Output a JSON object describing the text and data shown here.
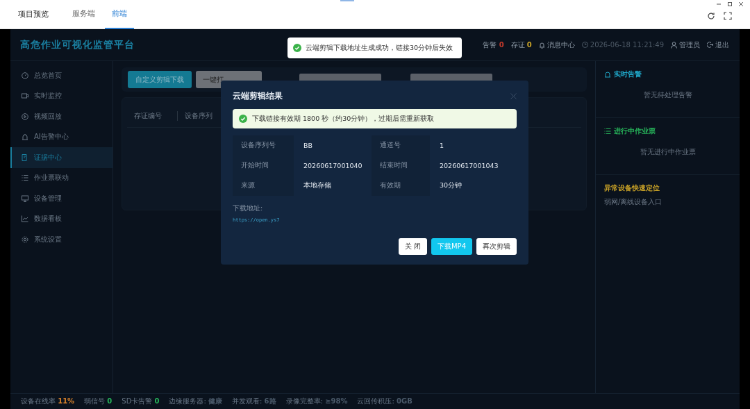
{
  "app_title": "项目预览",
  "top_tabs": [
    {
      "label": "服务端",
      "selected": false
    },
    {
      "label": "前端",
      "selected": true
    }
  ],
  "header": {
    "title": "高危作业可视化监管平台",
    "alarm_label": "告警",
    "alarm_count": "0",
    "evidence_label": "存证",
    "evidence_count": "0",
    "messages": "消息中心",
    "time": "2026-06-18 11:21:49",
    "user": "管理员",
    "logout": "退出"
  },
  "sidebar": [
    {
      "label": "总览首页",
      "selected": false
    },
    {
      "label": "实时监控",
      "selected": false
    },
    {
      "label": "视频回放",
      "selected": false
    },
    {
      "label": "AI告警中心",
      "selected": false
    },
    {
      "label": "证据中心",
      "selected": true
    },
    {
      "label": "作业票联动",
      "selected": false
    },
    {
      "label": "设备管理",
      "selected": false
    },
    {
      "label": "数据看板",
      "selected": false
    },
    {
      "label": "系统设置",
      "selected": false
    }
  ],
  "toolbar": {
    "primary": "自定义剪辑下载",
    "secondary": "一键打"
  },
  "table": {
    "columns": [
      "存证编号",
      "设备序列"
    ]
  },
  "right_panel": [
    {
      "title": "实时告警",
      "color": "#1fa3c4",
      "empty": "暂无待处理告警"
    },
    {
      "title": "进行中作业票",
      "color": "#27b35a",
      "empty": "暂无进行中作业票"
    },
    {
      "title": "异常设备快速定位",
      "color": "#c9a227",
      "empty": "弱网/离线设备入口"
    }
  ],
  "status_bar": [
    {
      "label": "设备在线率",
      "value": "11%",
      "color": "#d9822b"
    },
    {
      "label": "弱信号",
      "value": "0",
      "color": "#27b35a"
    },
    {
      "label": "SD卡告警",
      "value": "0",
      "color": "#27b35a"
    },
    {
      "label": "边缘服务器:",
      "value": "健康",
      "color": "#4b5a6a"
    },
    {
      "label": "并发观看:",
      "value": "6路",
      "color": "#4b5a6a"
    },
    {
      "label": "录像完整率:",
      "value": "≥98%",
      "color": "#4b5a6a"
    },
    {
      "label": "云回传积压:",
      "value": "0GB",
      "color": "#4b5a6a"
    }
  ],
  "toast": {
    "message": "云端剪辑下载地址生成成功，链接30分钟后失效"
  },
  "dialog": {
    "title": "云端剪辑结果",
    "notice": "下载链接有效期 1800 秒（约30分钟），过期后需重新获取",
    "fields": [
      {
        "label": "设备序列号",
        "value": "BB"
      },
      {
        "label": "通道号",
        "value": "1"
      },
      {
        "label": "开始时间",
        "value": "20260617001040"
      },
      {
        "label": "结束时间",
        "value": "20260617001043"
      },
      {
        "label": "来源",
        "value": "本地存储"
      },
      {
        "label": "有效期",
        "value": "30分钟"
      }
    ],
    "url_label": "下载地址:",
    "url": "https://open.ys7",
    "buttons": [
      {
        "label": "关 闭",
        "kind": "plain"
      },
      {
        "label": "下载MP4",
        "kind": "primary"
      },
      {
        "label": "再次剪辑",
        "kind": "plain"
      }
    ]
  }
}
